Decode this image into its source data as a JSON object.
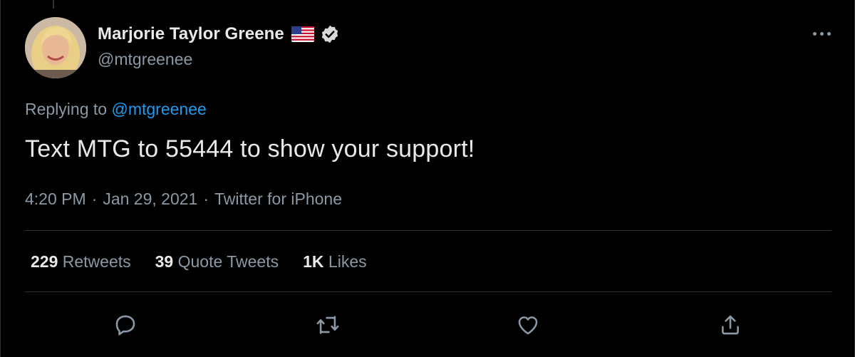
{
  "author": {
    "display_name": "Marjorie Taylor Greene",
    "handle": "@mtgreenee",
    "flag_icon": "us-flag-emoji",
    "verified_icon": "verified-badge-icon"
  },
  "reply": {
    "prefix": "Replying to",
    "mention": "@mtgreenee"
  },
  "tweet": {
    "text": "Text MTG to 55444 to show your support!",
    "time": "4:20 PM",
    "separator": "·",
    "date": "Jan 29, 2021",
    "source": "Twitter for iPhone"
  },
  "stats": {
    "retweets": {
      "count": "229",
      "label": "Retweets"
    },
    "quotes": {
      "count": "39",
      "label": "Quote Tweets"
    },
    "likes": {
      "count": "1K",
      "label": "Likes"
    }
  },
  "actions": [
    "reply-icon",
    "retweet-icon",
    "like-icon",
    "share-icon"
  ],
  "colors": {
    "background": "#000000",
    "text": "#e7e9ea",
    "secondary_text": "#8b98a5",
    "link": "#1d9bf0",
    "divider": "#2f3336"
  }
}
